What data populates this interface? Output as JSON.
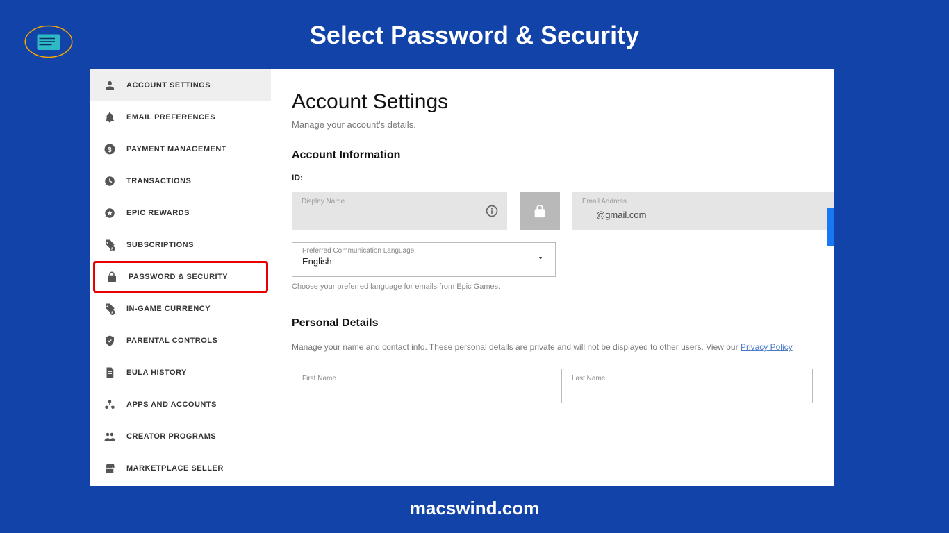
{
  "overlay": {
    "title": "Select Password & Security",
    "footer": "macswind.com"
  },
  "sidebar": {
    "items": [
      {
        "label": "ACCOUNT SETTINGS",
        "icon": "person",
        "active": true
      },
      {
        "label": "EMAIL PREFERENCES",
        "icon": "bell"
      },
      {
        "label": "PAYMENT MANAGEMENT",
        "icon": "dollar"
      },
      {
        "label": "TRANSACTIONS",
        "icon": "clock"
      },
      {
        "label": "EPIC REWARDS",
        "icon": "star-circle"
      },
      {
        "label": "SUBSCRIPTIONS",
        "icon": "tag-sub"
      },
      {
        "label": "PASSWORD & SECURITY",
        "icon": "lock",
        "highlighted": true
      },
      {
        "label": "IN-GAME CURRENCY",
        "icon": "tag-currency"
      },
      {
        "label": "PARENTAL CONTROLS",
        "icon": "shield"
      },
      {
        "label": "EULA HISTORY",
        "icon": "doc"
      },
      {
        "label": "APPS AND ACCOUNTS",
        "icon": "apps"
      },
      {
        "label": "CREATOR PROGRAMS",
        "icon": "people"
      },
      {
        "label": "MARKETPLACE SELLER",
        "icon": "store"
      }
    ]
  },
  "main": {
    "title": "Account Settings",
    "subtitle": "Manage your account's details.",
    "section1_title": "Account Information",
    "id_label": "ID:",
    "display_name_label": "Display Name",
    "display_name_value": "",
    "email_label": "Email Address",
    "email_value": "@gmail.com",
    "language_label": "Preferred Communication Language",
    "language_value": "English",
    "language_helper": "Choose your preferred language for emails from Epic Games.",
    "section2_title": "Personal Details",
    "pd_desc_prefix": "Manage your name and contact info. These personal details are private and will not be displayed to other users. View our ",
    "pd_link": "Privacy Policy",
    "first_name_label": "First Name",
    "last_name_label": "Last Name"
  }
}
